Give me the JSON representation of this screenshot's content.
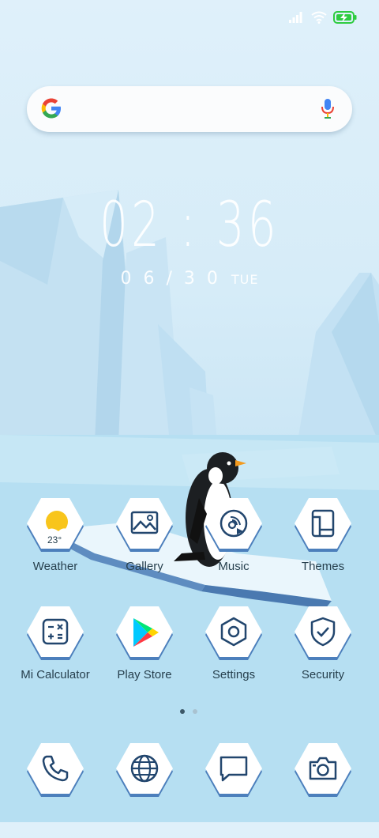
{
  "status": {
    "icons": [
      "signal-icon",
      "wifi-icon",
      "battery-charging-icon"
    ],
    "battery_color": "#2ecc40"
  },
  "search": {
    "icon": "google-g-icon",
    "mic_icon": "mic-icon"
  },
  "clock": {
    "time": "02:36",
    "date": "06/30",
    "weekday": "TUE"
  },
  "apps": [
    {
      "label": "Weather",
      "icon": "weather-icon",
      "temp": "23°"
    },
    {
      "label": "Gallery",
      "icon": "gallery-icon"
    },
    {
      "label": "Music",
      "icon": "music-icon"
    },
    {
      "label": "Themes",
      "icon": "themes-icon"
    },
    {
      "label": "Mi Calculator",
      "icon": "calculator-icon"
    },
    {
      "label": "Play Store",
      "icon": "play-store-icon"
    },
    {
      "label": "Settings",
      "icon": "settings-icon"
    },
    {
      "label": "Security",
      "icon": "security-icon"
    }
  ],
  "pager": {
    "pages": 2,
    "active": 1
  },
  "dock": [
    {
      "icon": "phone-icon"
    },
    {
      "icon": "browser-icon"
    },
    {
      "icon": "messages-icon"
    },
    {
      "icon": "camera-icon"
    }
  ],
  "colors": {
    "icon_stroke": "#22466e",
    "label": "#27404e"
  }
}
